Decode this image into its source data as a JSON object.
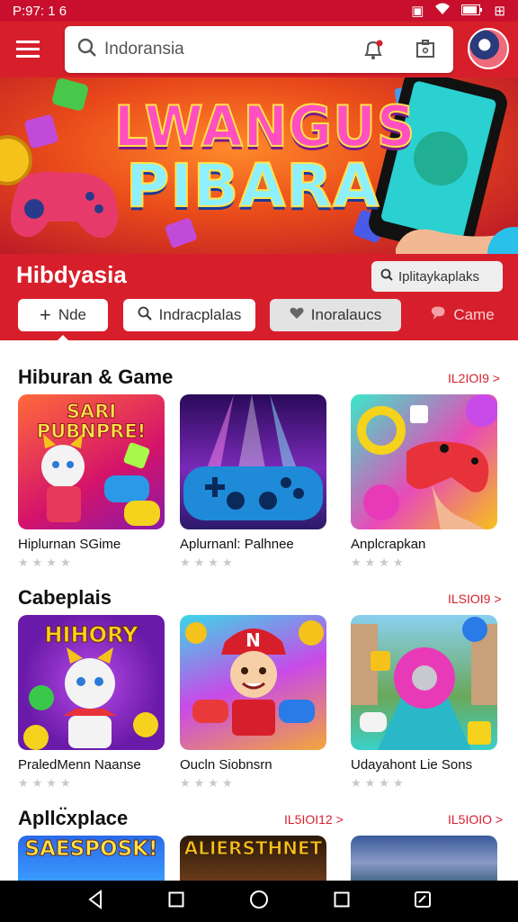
{
  "status": {
    "time": "P:97: 1 6"
  },
  "topbar": {
    "search_placeholder": "Indoransia"
  },
  "banner": {
    "line1": "LWANGUS",
    "line2": "PIBARA"
  },
  "header": {
    "title": "Hibdyasia",
    "search_label": "Iplitaykaplaks"
  },
  "chips": [
    {
      "label": "Nde",
      "icon": "plus-icon"
    },
    {
      "label": "Indracplalas",
      "icon": "search-icon"
    },
    {
      "label": "Inoralaucs",
      "icon": "heart-icon"
    },
    {
      "label": "Came",
      "icon": "chat-icon"
    }
  ],
  "sections": [
    {
      "title": "Hiburan & Game",
      "more": "IL2IOI9 >",
      "items": [
        {
          "name": "Hiplurnan SGime",
          "art": "SARI PUBNPRE!"
        },
        {
          "name": "Aplurnanl: Palhnee",
          "art": ""
        },
        {
          "name": "Anplcrapkan",
          "art": ""
        }
      ]
    },
    {
      "title": "Cabeplais",
      "more": "ILSIOI9 >",
      "items": [
        {
          "name": "PraledMenn Naanse",
          "art": "HIHORY"
        },
        {
          "name": "Oucln Siobnsrn",
          "art": "N"
        },
        {
          "name": "Udayahont Lie Sons",
          "art": ""
        }
      ]
    },
    {
      "title": "Apllc̈xplace",
      "more": "IL5IOI12 >",
      "more2": "IL5IOIO >",
      "items": [
        {
          "name": "",
          "art": "SAESPOSK!"
        },
        {
          "name": "",
          "art": "ALIERSTHNET"
        },
        {
          "name": "",
          "art": ""
        }
      ]
    }
  ],
  "colors": {
    "brand": "#d71f2b",
    "accent": "#c8102e"
  }
}
